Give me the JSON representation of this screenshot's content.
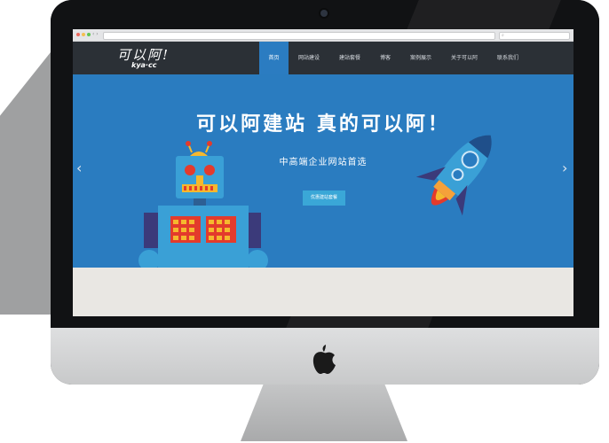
{
  "browser": {
    "nav_glyph": "‹ ›",
    "search_glyph": "⌕"
  },
  "site": {
    "logo_main": "可以阿!",
    "logo_sub": "kya·cc",
    "nav": [
      "首页",
      "网站建设",
      "建站套餐",
      "博客",
      "案例展示",
      "关于可以阿",
      "联系我们"
    ],
    "active_nav_index": 0
  },
  "hero": {
    "title": "可以阿建站 真的可以阿！",
    "subtitle": "中高端企业网站首选",
    "cta": "优惠建站套餐",
    "prev_glyph": "‹",
    "next_glyph": "›"
  },
  "colors": {
    "hero_bg": "#2a7cc0",
    "header_bg": "#2b3036",
    "nav_active": "#2b7cc1",
    "cta_bg": "#3aa7d7"
  },
  "icons": {
    "apple": "apple-logo-icon",
    "robot": "robot-illustration",
    "rocket": "rocket-illustration"
  }
}
